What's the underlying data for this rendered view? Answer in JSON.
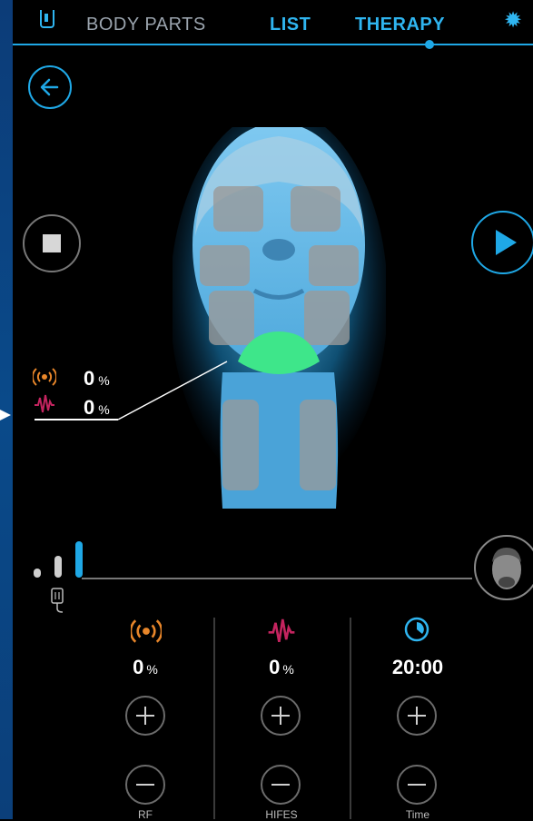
{
  "nav": {
    "tabs": [
      "BODY PARTS",
      "LIST",
      "THERAPY"
    ],
    "icons": {
      "applicator": "applicator-icon",
      "settings": "gear-icon"
    }
  },
  "zone_readout": {
    "rf_value": "0",
    "rf_unit": "%",
    "hifes_value": "0",
    "hifes_unit": "%"
  },
  "controls": {
    "rf": {
      "value": "0",
      "unit": "%",
      "label": "RF"
    },
    "hifes": {
      "value": "0",
      "unit": "%",
      "label": "HIFES"
    },
    "time": {
      "value": "20:00",
      "label": "Time"
    }
  },
  "colors": {
    "accent": "#1fa8e6",
    "rf": "#e8862a",
    "hifes": "#c4245f",
    "active_zone": "#3ee68a"
  }
}
